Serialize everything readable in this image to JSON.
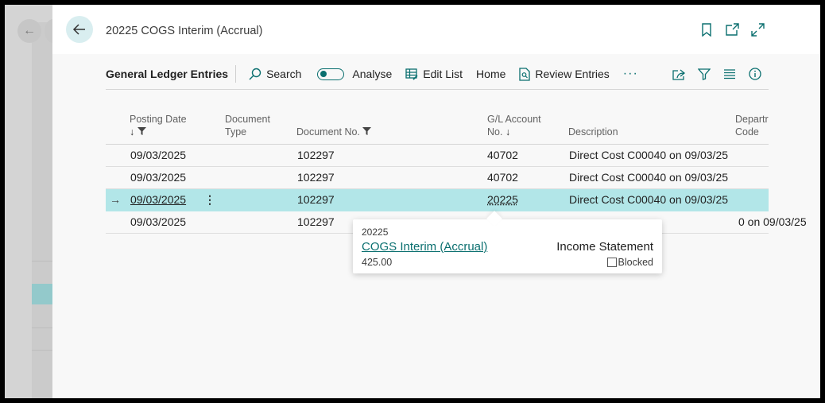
{
  "page_title": "20225 COGS Interim (Accrual)",
  "actionbar": {
    "title": "General Ledger Entries",
    "search": "Search",
    "analyse": "Analyse",
    "edit_list": "Edit List",
    "home": "Home",
    "review_entries": "Review Entries",
    "more": "···"
  },
  "columns": {
    "posting_date": "Posting Date",
    "document_type_1": "Document",
    "document_type_2": "Type",
    "document_no": "Document No.",
    "gl_account_1": "G/L Account",
    "gl_account_2": "No.",
    "description": "Description",
    "department_1": "Departr",
    "department_2": "Code"
  },
  "rows": [
    {
      "posting_date": "09/03/2025",
      "document_no": "102297",
      "gl_account": "40702",
      "description": "Direct Cost C00040 on 09/03/25"
    },
    {
      "posting_date": "09/03/2025",
      "document_no": "102297",
      "gl_account": "40702",
      "description": "Direct Cost C00040 on 09/03/25"
    },
    {
      "posting_date": "09/03/2025",
      "document_no": "102297",
      "gl_account": "20225",
      "description": "Direct Cost C00040 on 09/03/25"
    },
    {
      "posting_date": "09/03/2025",
      "document_no": "102297",
      "gl_account": "",
      "description": "0 on 09/03/25"
    }
  ],
  "tooltip": {
    "account_no": "20225",
    "account_name": "COGS Interim (Accrual)",
    "amount": "425.00",
    "income_balance": "Income Statement",
    "blocked_label": "Blocked"
  },
  "colors": {
    "accent": "#0a6f6f",
    "selected_row": "#b2e6e8"
  }
}
